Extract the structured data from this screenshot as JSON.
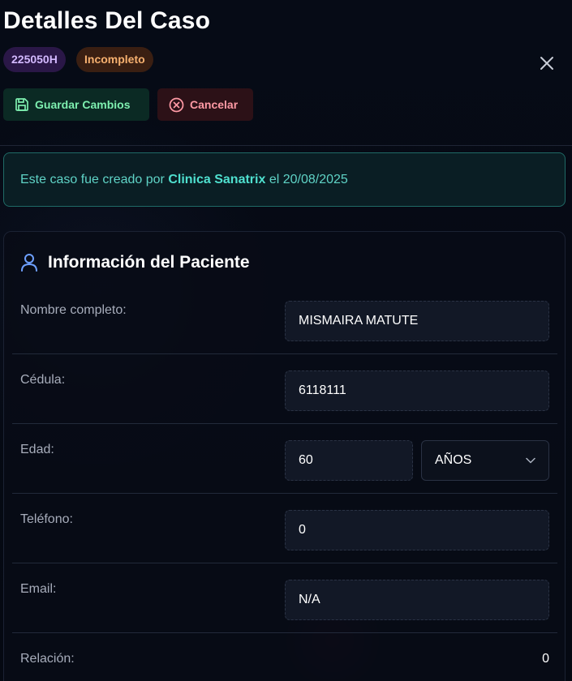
{
  "header": {
    "title": "Detalles Del Caso",
    "case_id": "225050H",
    "status": "Incompleto",
    "save_label": "Guardar Cambios",
    "cancel_label": "Cancelar"
  },
  "notice": {
    "prefix": "Este caso fue creado por ",
    "creator": "Clinica Sanatrix",
    "middle": " el ",
    "date": "20/08/2025"
  },
  "patient": {
    "section_title": "Información del Paciente",
    "fields": {
      "name": {
        "label": "Nombre completo:",
        "value": "MISMAIRA MATUTE"
      },
      "id_number": {
        "label": "Cédula:",
        "value": "6118111"
      },
      "age": {
        "label": "Edad:",
        "value": "60",
        "unit": "AÑOS"
      },
      "phone": {
        "label": "Teléfono:",
        "value": "0"
      },
      "email": {
        "label": "Email:",
        "value": "N/A"
      },
      "relation": {
        "label": "Relación:",
        "value": "0"
      }
    }
  },
  "colors": {
    "background": "#050a14",
    "save_accent": "#7ef0b0",
    "cancel_accent": "#ff9aa5",
    "notice_accent": "#4fe0cf",
    "id_badge": "#2a1747",
    "status_badge": "#3a1f12"
  },
  "icons": {
    "close": "close-icon",
    "save": "save-icon",
    "cancel": "cancel-circle-icon",
    "user": "user-icon",
    "chevron": "chevron-down-icon"
  }
}
